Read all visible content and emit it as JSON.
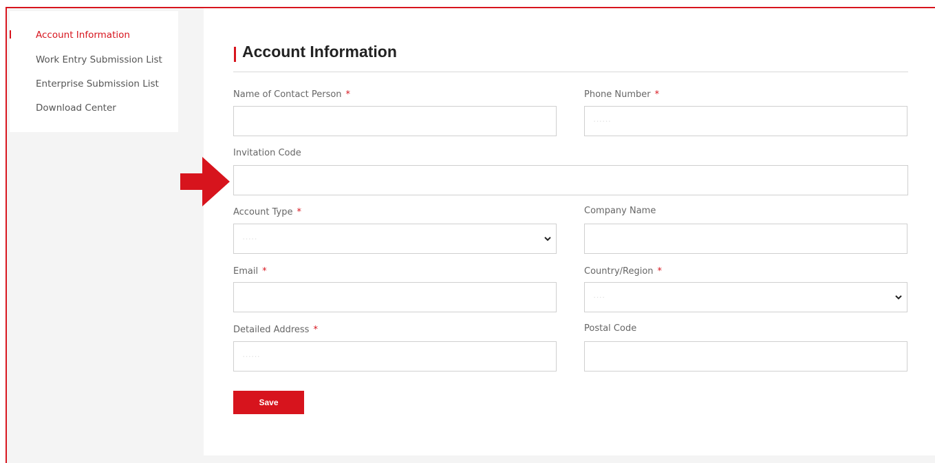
{
  "colors": {
    "accent": "#d7141d",
    "sidebar_bg": "#f4f4f4",
    "text_muted": "#666666"
  },
  "sidebar": {
    "items": [
      {
        "label": "Account Information",
        "active": true
      },
      {
        "label": "Work Entry Submission List",
        "active": false
      },
      {
        "label": "Enterprise Submission List",
        "active": false
      },
      {
        "label": "Download Center",
        "active": false
      }
    ]
  },
  "page": {
    "title": "Account Information"
  },
  "form": {
    "required_mark": "*",
    "contact_name": {
      "label": "Name of Contact Person",
      "value": ""
    },
    "phone": {
      "label": "Phone Number",
      "value": "······"
    },
    "invitation_code": {
      "label": "Invitation Code",
      "value": ""
    },
    "account_type": {
      "label": "Account Type",
      "value": "·····"
    },
    "company_name": {
      "label": "Company Name",
      "value": ""
    },
    "email": {
      "label": "Email",
      "value": ""
    },
    "country_region": {
      "label": "Country/Region",
      "value": "····"
    },
    "detailed_address": {
      "label": "Detailed Address",
      "value": "······"
    },
    "postal_code": {
      "label": "Postal Code",
      "value": ""
    },
    "save_label": "Save"
  },
  "annotation": {
    "icon": "red-arrow-icon"
  }
}
